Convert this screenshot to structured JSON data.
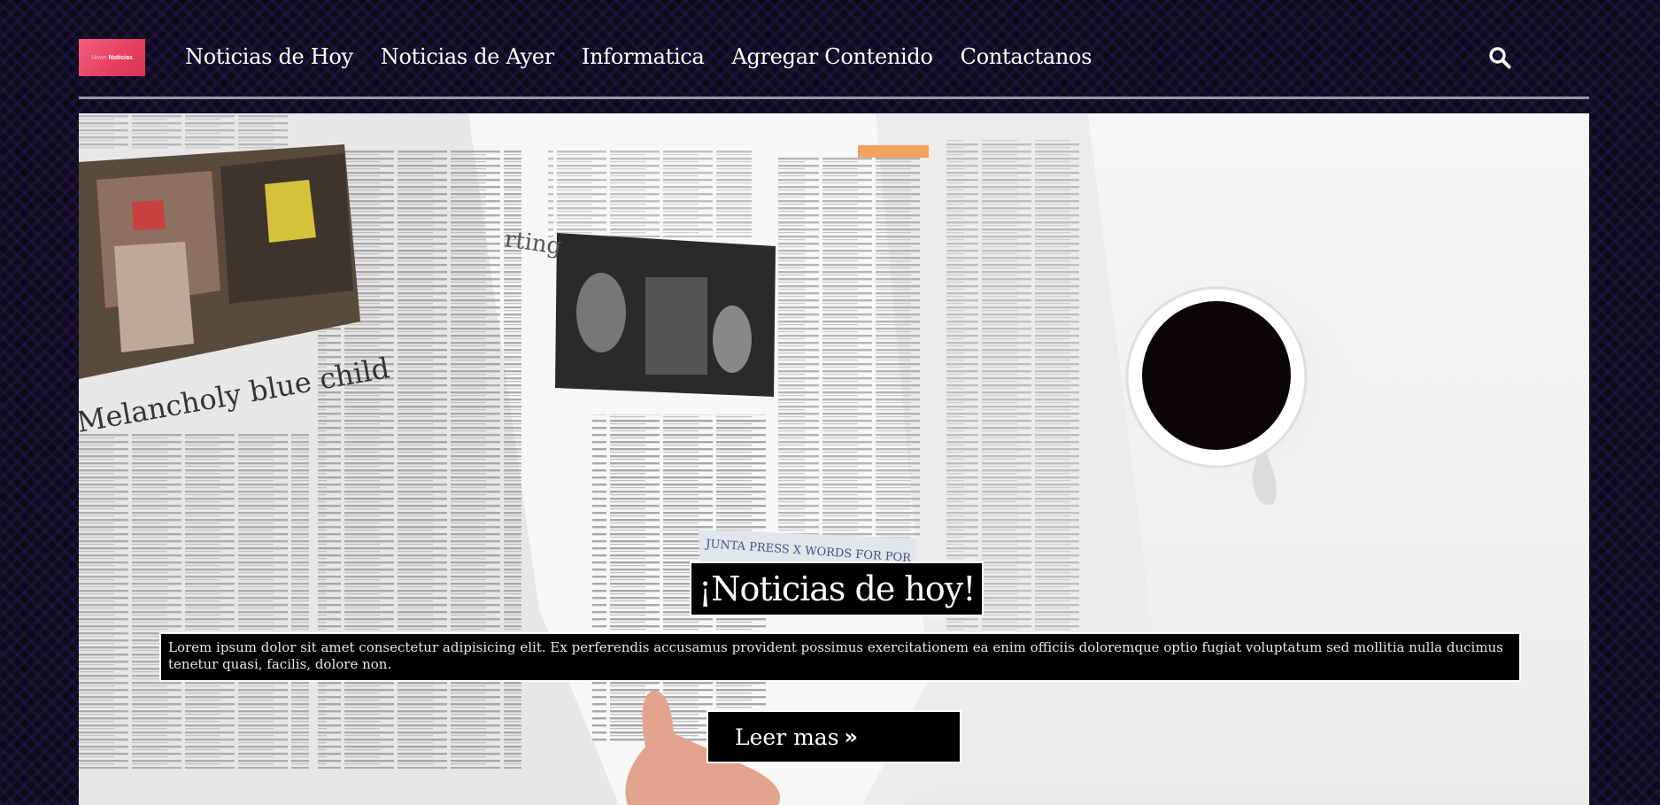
{
  "header": {
    "logo": {
      "faint_text": "News",
      "strong_text": "Noticias"
    },
    "nav": [
      {
        "label": "Noticias de Hoy"
      },
      {
        "label": "Noticias de Ayer"
      },
      {
        "label": "Informatica"
      },
      {
        "label": "Agregar Contenido"
      },
      {
        "label": "Contactanos"
      }
    ],
    "search_icon": "search-icon"
  },
  "hero": {
    "image": "newspaper-and-coffee-photo",
    "title": "¡Noticias de hoy!",
    "description": "Lorem ipsum dolor sit amet consectetur adipisicing elit. Ex perferendis accusamus provident possimus exercitationem ea enim officiis doloremque optio fugiat voluptatum sed mollitia nulla ducimus tenetur quasi, facilis, dolore non.",
    "button": {
      "label": "Leer mas",
      "icon": "»"
    },
    "photo_text": {
      "headline": "Melancholy blue child",
      "caption": "JUNTA PRESS X WORDS FOR POR",
      "side_heading": "rting"
    }
  },
  "colors": {
    "background": "#0d0a1c",
    "logo": "#e63f5d",
    "divider": "#9b96a8",
    "box": "#000000",
    "text": "#ffffff"
  }
}
